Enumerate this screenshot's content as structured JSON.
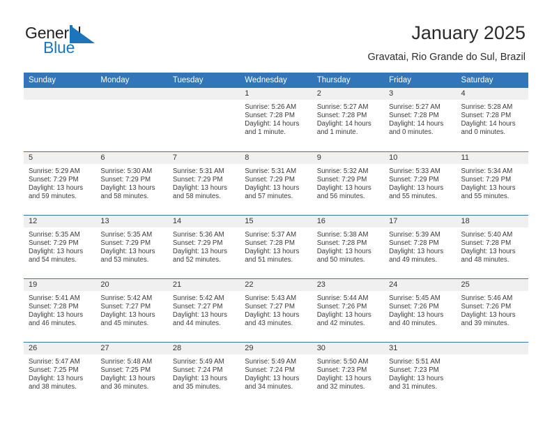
{
  "logo": {
    "word1": "General",
    "word2": "Blue",
    "flag_icon": "triangle-flag-icon",
    "color_dark": "#231f20",
    "color_blue": "#1b75bc"
  },
  "header": {
    "title": "January 2025",
    "location": "Gravatai, Rio Grande do Sul, Brazil"
  },
  "theme": {
    "header_blue": "#3275b8",
    "date_strip_gray": "#f0f0f0",
    "text": "#3a3a3a"
  },
  "calendar": {
    "weekday_headers": [
      "Sunday",
      "Monday",
      "Tuesday",
      "Wednesday",
      "Thursday",
      "Friday",
      "Saturday"
    ],
    "weeks": [
      [
        {
          "date": "",
          "empty": true,
          "lines": []
        },
        {
          "date": "",
          "empty": true,
          "lines": []
        },
        {
          "date": "",
          "empty": true,
          "lines": []
        },
        {
          "date": "1",
          "empty": false,
          "lines": [
            "Sunrise: 5:26 AM",
            "Sunset: 7:28 PM",
            "Daylight: 14 hours",
            "and 1 minute."
          ]
        },
        {
          "date": "2",
          "empty": false,
          "lines": [
            "Sunrise: 5:27 AM",
            "Sunset: 7:28 PM",
            "Daylight: 14 hours",
            "and 1 minute."
          ]
        },
        {
          "date": "3",
          "empty": false,
          "lines": [
            "Sunrise: 5:27 AM",
            "Sunset: 7:28 PM",
            "Daylight: 14 hours",
            "and 0 minutes."
          ]
        },
        {
          "date": "4",
          "empty": false,
          "lines": [
            "Sunrise: 5:28 AM",
            "Sunset: 7:28 PM",
            "Daylight: 14 hours",
            "and 0 minutes."
          ]
        }
      ],
      [
        {
          "date": "5",
          "empty": false,
          "lines": [
            "Sunrise: 5:29 AM",
            "Sunset: 7:29 PM",
            "Daylight: 13 hours",
            "and 59 minutes."
          ]
        },
        {
          "date": "6",
          "empty": false,
          "lines": [
            "Sunrise: 5:30 AM",
            "Sunset: 7:29 PM",
            "Daylight: 13 hours",
            "and 58 minutes."
          ]
        },
        {
          "date": "7",
          "empty": false,
          "lines": [
            "Sunrise: 5:31 AM",
            "Sunset: 7:29 PM",
            "Daylight: 13 hours",
            "and 58 minutes."
          ]
        },
        {
          "date": "8",
          "empty": false,
          "lines": [
            "Sunrise: 5:31 AM",
            "Sunset: 7:29 PM",
            "Daylight: 13 hours",
            "and 57 minutes."
          ]
        },
        {
          "date": "9",
          "empty": false,
          "lines": [
            "Sunrise: 5:32 AM",
            "Sunset: 7:29 PM",
            "Daylight: 13 hours",
            "and 56 minutes."
          ]
        },
        {
          "date": "10",
          "empty": false,
          "lines": [
            "Sunrise: 5:33 AM",
            "Sunset: 7:29 PM",
            "Daylight: 13 hours",
            "and 55 minutes."
          ]
        },
        {
          "date": "11",
          "empty": false,
          "lines": [
            "Sunrise: 5:34 AM",
            "Sunset: 7:29 PM",
            "Daylight: 13 hours",
            "and 55 minutes."
          ]
        }
      ],
      [
        {
          "date": "12",
          "empty": false,
          "lines": [
            "Sunrise: 5:35 AM",
            "Sunset: 7:29 PM",
            "Daylight: 13 hours",
            "and 54 minutes."
          ]
        },
        {
          "date": "13",
          "empty": false,
          "lines": [
            "Sunrise: 5:35 AM",
            "Sunset: 7:29 PM",
            "Daylight: 13 hours",
            "and 53 minutes."
          ]
        },
        {
          "date": "14",
          "empty": false,
          "lines": [
            "Sunrise: 5:36 AM",
            "Sunset: 7:29 PM",
            "Daylight: 13 hours",
            "and 52 minutes."
          ]
        },
        {
          "date": "15",
          "empty": false,
          "lines": [
            "Sunrise: 5:37 AM",
            "Sunset: 7:28 PM",
            "Daylight: 13 hours",
            "and 51 minutes."
          ]
        },
        {
          "date": "16",
          "empty": false,
          "lines": [
            "Sunrise: 5:38 AM",
            "Sunset: 7:28 PM",
            "Daylight: 13 hours",
            "and 50 minutes."
          ]
        },
        {
          "date": "17",
          "empty": false,
          "lines": [
            "Sunrise: 5:39 AM",
            "Sunset: 7:28 PM",
            "Daylight: 13 hours",
            "and 49 minutes."
          ]
        },
        {
          "date": "18",
          "empty": false,
          "lines": [
            "Sunrise: 5:40 AM",
            "Sunset: 7:28 PM",
            "Daylight: 13 hours",
            "and 48 minutes."
          ]
        }
      ],
      [
        {
          "date": "19",
          "empty": false,
          "lines": [
            "Sunrise: 5:41 AM",
            "Sunset: 7:28 PM",
            "Daylight: 13 hours",
            "and 46 minutes."
          ]
        },
        {
          "date": "20",
          "empty": false,
          "lines": [
            "Sunrise: 5:42 AM",
            "Sunset: 7:27 PM",
            "Daylight: 13 hours",
            "and 45 minutes."
          ]
        },
        {
          "date": "21",
          "empty": false,
          "lines": [
            "Sunrise: 5:42 AM",
            "Sunset: 7:27 PM",
            "Daylight: 13 hours",
            "and 44 minutes."
          ]
        },
        {
          "date": "22",
          "empty": false,
          "lines": [
            "Sunrise: 5:43 AM",
            "Sunset: 7:27 PM",
            "Daylight: 13 hours",
            "and 43 minutes."
          ]
        },
        {
          "date": "23",
          "empty": false,
          "lines": [
            "Sunrise: 5:44 AM",
            "Sunset: 7:26 PM",
            "Daylight: 13 hours",
            "and 42 minutes."
          ]
        },
        {
          "date": "24",
          "empty": false,
          "lines": [
            "Sunrise: 5:45 AM",
            "Sunset: 7:26 PM",
            "Daylight: 13 hours",
            "and 40 minutes."
          ]
        },
        {
          "date": "25",
          "empty": false,
          "lines": [
            "Sunrise: 5:46 AM",
            "Sunset: 7:26 PM",
            "Daylight: 13 hours",
            "and 39 minutes."
          ]
        }
      ],
      [
        {
          "date": "26",
          "empty": false,
          "lines": [
            "Sunrise: 5:47 AM",
            "Sunset: 7:25 PM",
            "Daylight: 13 hours",
            "and 38 minutes."
          ]
        },
        {
          "date": "27",
          "empty": false,
          "lines": [
            "Sunrise: 5:48 AM",
            "Sunset: 7:25 PM",
            "Daylight: 13 hours",
            "and 36 minutes."
          ]
        },
        {
          "date": "28",
          "empty": false,
          "lines": [
            "Sunrise: 5:49 AM",
            "Sunset: 7:24 PM",
            "Daylight: 13 hours",
            "and 35 minutes."
          ]
        },
        {
          "date": "29",
          "empty": false,
          "lines": [
            "Sunrise: 5:49 AM",
            "Sunset: 7:24 PM",
            "Daylight: 13 hours",
            "and 34 minutes."
          ]
        },
        {
          "date": "30",
          "empty": false,
          "lines": [
            "Sunrise: 5:50 AM",
            "Sunset: 7:23 PM",
            "Daylight: 13 hours",
            "and 32 minutes."
          ]
        },
        {
          "date": "31",
          "empty": false,
          "lines": [
            "Sunrise: 5:51 AM",
            "Sunset: 7:23 PM",
            "Daylight: 13 hours",
            "and 31 minutes."
          ]
        },
        {
          "date": "",
          "empty": true,
          "lines": []
        }
      ]
    ]
  }
}
